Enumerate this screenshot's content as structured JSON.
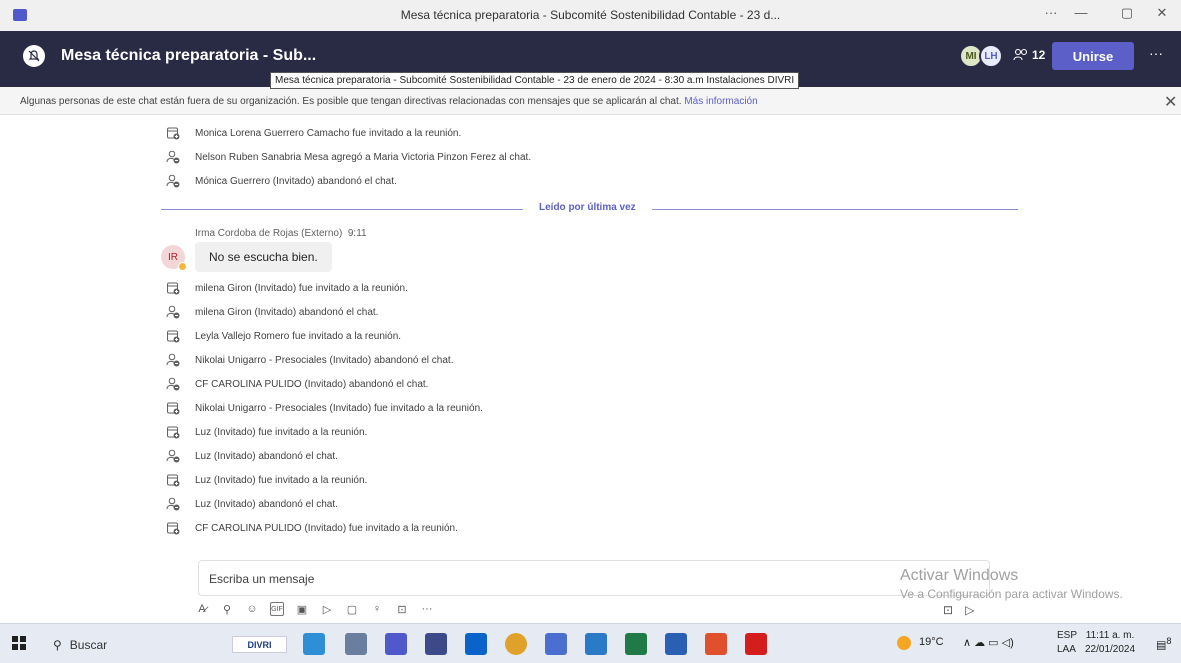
{
  "window": {
    "title": "Mesa técnica preparatoria - Subcomité Sostenibilidad Contable - 23 d...",
    "controls": [
      "···",
      "—",
      "▢",
      "✕"
    ]
  },
  "header": {
    "title": "Mesa técnica preparatoria - Sub...",
    "avatars": [
      "MI",
      "LH"
    ],
    "participant_count": "12",
    "join_label": "Unirse",
    "more": "···"
  },
  "tooltip": "Mesa técnica preparatoria - Subcomité Sostenibilidad Contable - 23 de enero de 2024 - 8:30 a.m Instalaciones DIVRI",
  "banner": {
    "text": "Algunas personas de este chat están fuera de su organización. Es posible que tengan directivas relacionadas con mensajes que se aplicarán al chat.",
    "link": "Más información"
  },
  "events_before": [
    {
      "icon": "calendar-add",
      "text": "Monica Lorena Guerrero Camacho fue invitado a la reunión."
    },
    {
      "icon": "person-add",
      "text": "Nelson Ruben Sanabria Mesa agregó a Maria Victoria Pinzon Ferez al chat."
    },
    {
      "icon": "person-leave",
      "text": "Mónica Guerrero (Invitado) abandonó el chat."
    }
  ],
  "divider_label": "Leído por última vez",
  "message": {
    "sender": "Irma Cordoba de Rojas (Externo)",
    "time": "9:11",
    "initials": "IR",
    "text": "No se escucha bien."
  },
  "events_after": [
    {
      "icon": "calendar-add",
      "text": "milena Giron (Invitado) fue invitado a la reunión."
    },
    {
      "icon": "person-leave",
      "text": "milena Giron (Invitado) abandonó el chat."
    },
    {
      "icon": "calendar-add",
      "text": "Leyla Vallejo Romero fue invitado a la reunión."
    },
    {
      "icon": "person-leave",
      "text": "Nikolai Unigarro - Presociales (Invitado) abandonó el chat."
    },
    {
      "icon": "person-leave",
      "text": "CF CAROLINA PULIDO (Invitado) abandonó el chat."
    },
    {
      "icon": "calendar-add",
      "text": "Nikolai Unigarro - Presociales (Invitado) fue invitado a la reunión."
    },
    {
      "icon": "calendar-add",
      "text": "Luz (Invitado) fue invitado a la reunión."
    },
    {
      "icon": "person-leave",
      "text": "Luz (Invitado) abandonó el chat."
    },
    {
      "icon": "calendar-add",
      "text": "Luz (Invitado) fue invitado a la reunión."
    },
    {
      "icon": "person-leave",
      "text": "Luz (Invitado) abandonó el chat."
    },
    {
      "icon": "calendar-add",
      "text": "CF CAROLINA PULIDO (Invitado) fue invitado a la reunión."
    }
  ],
  "compose": {
    "placeholder": "Escriba un mensaje",
    "more": "···"
  },
  "watermark": {
    "line1": "Activar Windows",
    "line2": "Ve a Configuración para activar Windows."
  },
  "taskbar": {
    "search": "Buscar",
    "divri": "DIVRI",
    "temperature": "19°C",
    "lang1": "ESP",
    "lang2": "LAA",
    "time": "11:11 a. m.",
    "date": "22/01/2024",
    "notif": "8"
  },
  "colors": {
    "header": "#292a44",
    "accent": "#5b5fc7"
  }
}
